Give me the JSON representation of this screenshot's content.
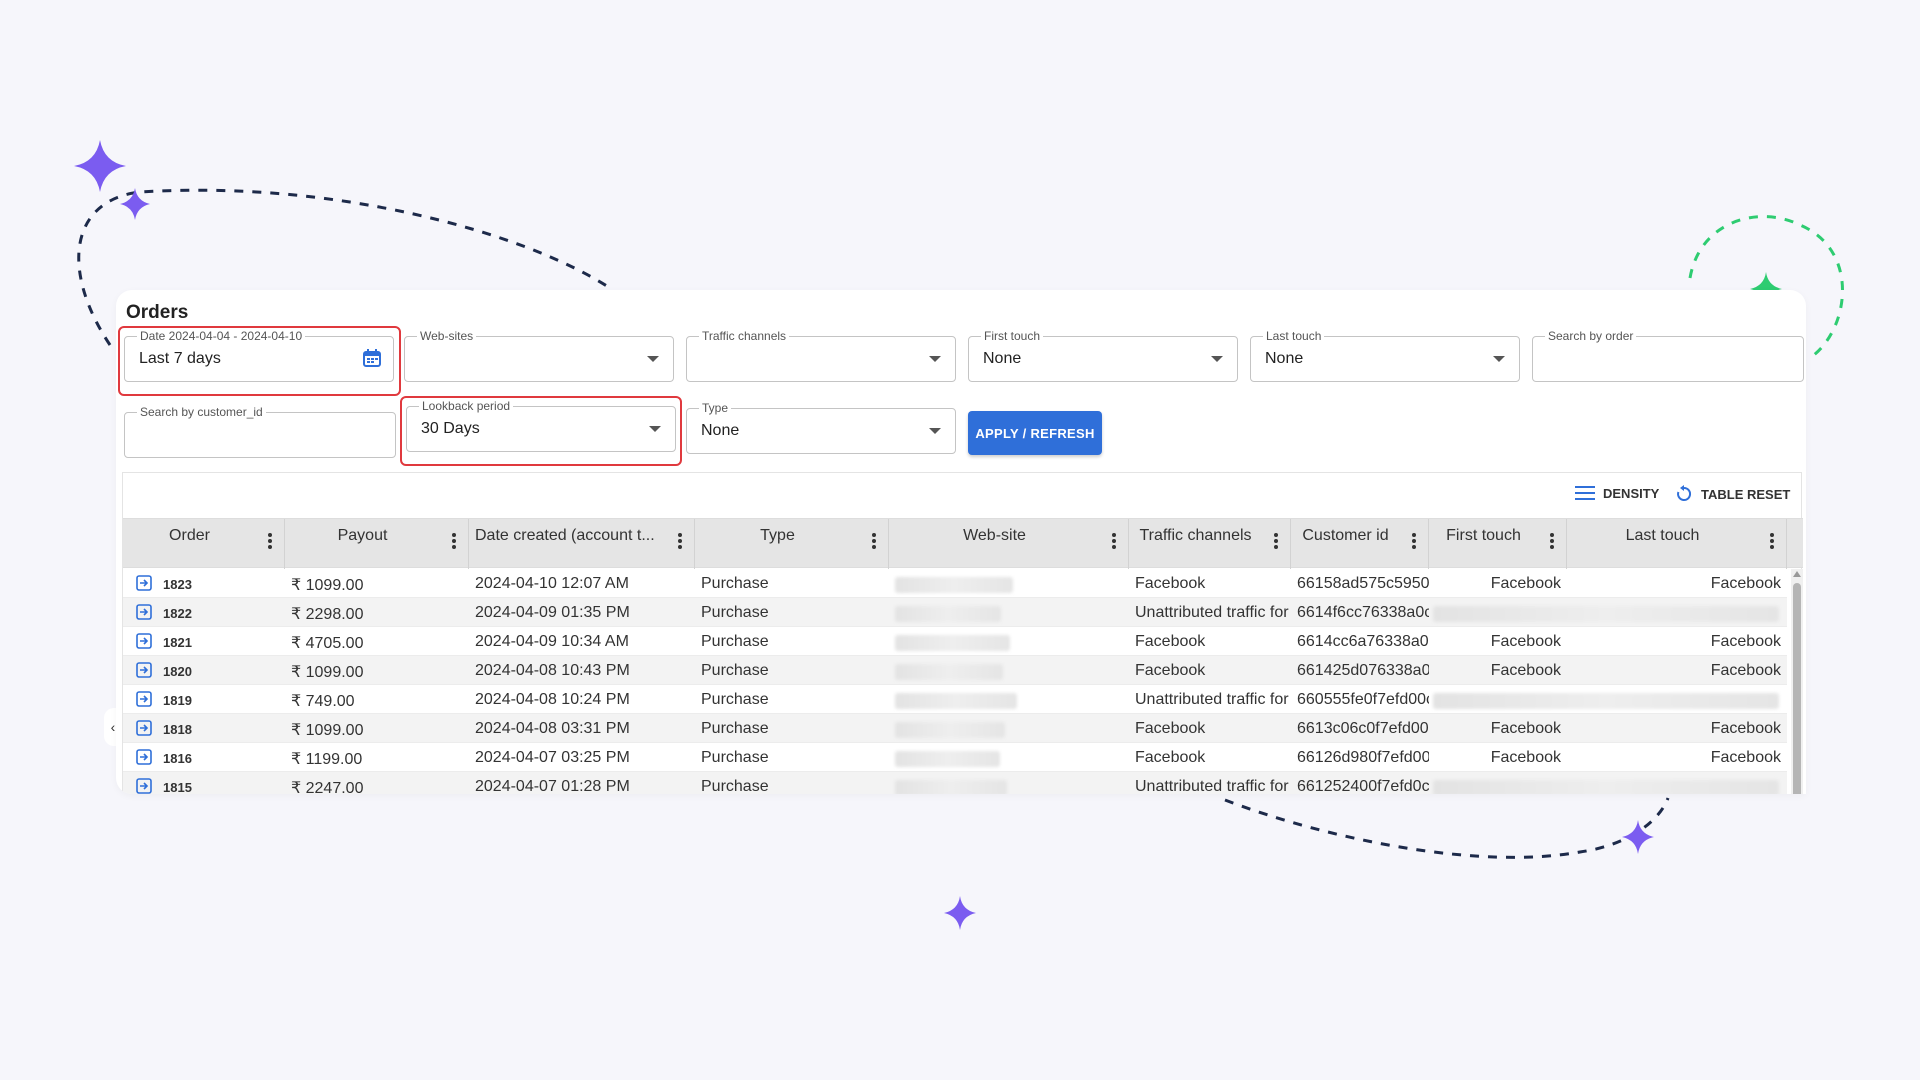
{
  "page": {
    "title": "Orders"
  },
  "filters": {
    "date": {
      "label": "Date 2024-04-04 - 2024-04-10",
      "value": "Last 7 days",
      "icon": "calendar-icon"
    },
    "websites": {
      "label": "Web-sites",
      "value": ""
    },
    "traffic_channels": {
      "label": "Traffic channels",
      "value": ""
    },
    "first_touch": {
      "label": "First touch",
      "value": "None"
    },
    "last_touch": {
      "label": "Last touch",
      "value": "None"
    },
    "search_order": {
      "label": "Search by order",
      "value": ""
    },
    "search_customer": {
      "label": "Search by customer_id",
      "value": ""
    },
    "lookback": {
      "label": "Lookback period",
      "value": "30 Days"
    },
    "type": {
      "label": "Type",
      "value": "None"
    },
    "apply_label": "APPLY / REFRESH"
  },
  "toolbar": {
    "density_label": "DENSITY",
    "reset_label": "TABLE RESET",
    "density_icon": "density-icon",
    "reset_icon": "reset-icon"
  },
  "table": {
    "columns": [
      "Order",
      "Payout",
      "Date created (account t...",
      "Type",
      "Web-site",
      "Traffic channels",
      "Customer id",
      "First touch",
      "Last touch"
    ],
    "rows": [
      {
        "order": "1823",
        "payout": "₹ 1099.00",
        "date": "2024-04-10 12:07 AM",
        "type": "Purchase",
        "traffic": "Facebook",
        "customer": "66158ad575c5950",
        "first": "Facebook",
        "last": "Facebook"
      },
      {
        "order": "1822",
        "payout": "₹ 2298.00",
        "date": "2024-04-09 01:35 PM",
        "type": "Purchase",
        "traffic": "Unattributed traffic for",
        "customer": "6614f6cc76338a0c",
        "first": "",
        "last": ""
      },
      {
        "order": "1821",
        "payout": "₹ 4705.00",
        "date": "2024-04-09 10:34 AM",
        "type": "Purchase",
        "traffic": "Facebook",
        "customer": "6614cc6a76338a0",
        "first": "Facebook",
        "last": "Facebook"
      },
      {
        "order": "1820",
        "payout": "₹ 1099.00",
        "date": "2024-04-08 10:43 PM",
        "type": "Purchase",
        "traffic": "Facebook",
        "customer": "661425d076338a0",
        "first": "Facebook",
        "last": "Facebook"
      },
      {
        "order": "1819",
        "payout": "₹ 749.00",
        "date": "2024-04-08 10:24 PM",
        "type": "Purchase",
        "traffic": "Unattributed traffic for",
        "customer": "660555fe0f7efd00c",
        "first": "",
        "last": ""
      },
      {
        "order": "1818",
        "payout": "₹ 1099.00",
        "date": "2024-04-08 03:31 PM",
        "type": "Purchase",
        "traffic": "Facebook",
        "customer": "6613c06c0f7efd00",
        "first": "Facebook",
        "last": "Facebook"
      },
      {
        "order": "1816",
        "payout": "₹ 1199.00",
        "date": "2024-04-07 03:25 PM",
        "type": "Purchase",
        "traffic": "Facebook",
        "customer": "66126d980f7efd00",
        "first": "Facebook",
        "last": "Facebook"
      },
      {
        "order": "1815",
        "payout": "₹ 2247.00",
        "date": "2024-04-07 01:28 PM",
        "type": "Purchase",
        "traffic": "Unattributed traffic for",
        "customer": "661252400f7efd0c",
        "first": "",
        "last": ""
      }
    ]
  },
  "colors": {
    "accent": "#2f6fd9",
    "highlight": "#e0393e",
    "sparkle_purple": "#7b5cf0",
    "sparkle_green": "#2ecc71"
  }
}
